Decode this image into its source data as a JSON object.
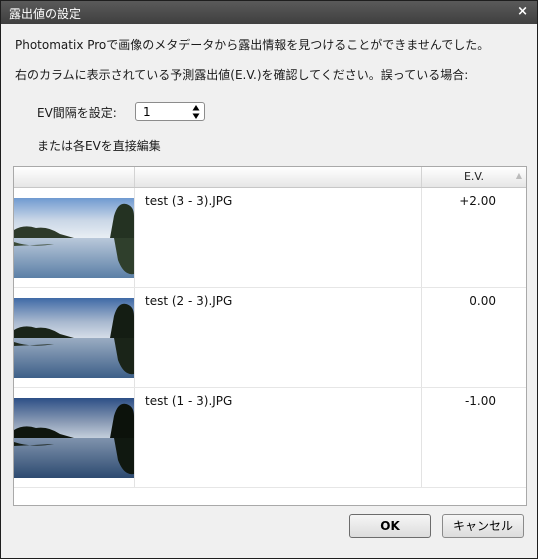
{
  "dialog": {
    "title": "露出値の設定",
    "close_glyph": "×"
  },
  "messages": {
    "line1": "Photomatix Proで画像のメタデータから露出情報を見つけることができませんでした。",
    "line2": "右のカラムに表示されている予測露出値(E.V.)を確認してください。誤っている場合:"
  },
  "ev_interval": {
    "label": "EV間隔を設定:",
    "selected": "1",
    "arrows_glyph": "▲▼"
  },
  "direct_edit_label": "または各EVを直接編集",
  "table": {
    "columns": [
      "",
      "",
      "E.V."
    ],
    "sort_glyph": "▲",
    "rows": [
      {
        "filename": "test (3 - 3).JPG",
        "ev": "+2.00",
        "thumb_brightness": "bright"
      },
      {
        "filename": "test (2 - 3).JPG",
        "ev": "0.00",
        "thumb_brightness": "normal"
      },
      {
        "filename": "test (1 - 3).JPG",
        "ev": "-1.00",
        "thumb_brightness": "dark"
      }
    ]
  },
  "buttons": {
    "ok": "OK",
    "cancel": "キャンセル"
  },
  "colors": {
    "titlebar": "#4a4a4a",
    "dialog_bg": "#f0f0f0",
    "table_bg": "#ffffff"
  }
}
